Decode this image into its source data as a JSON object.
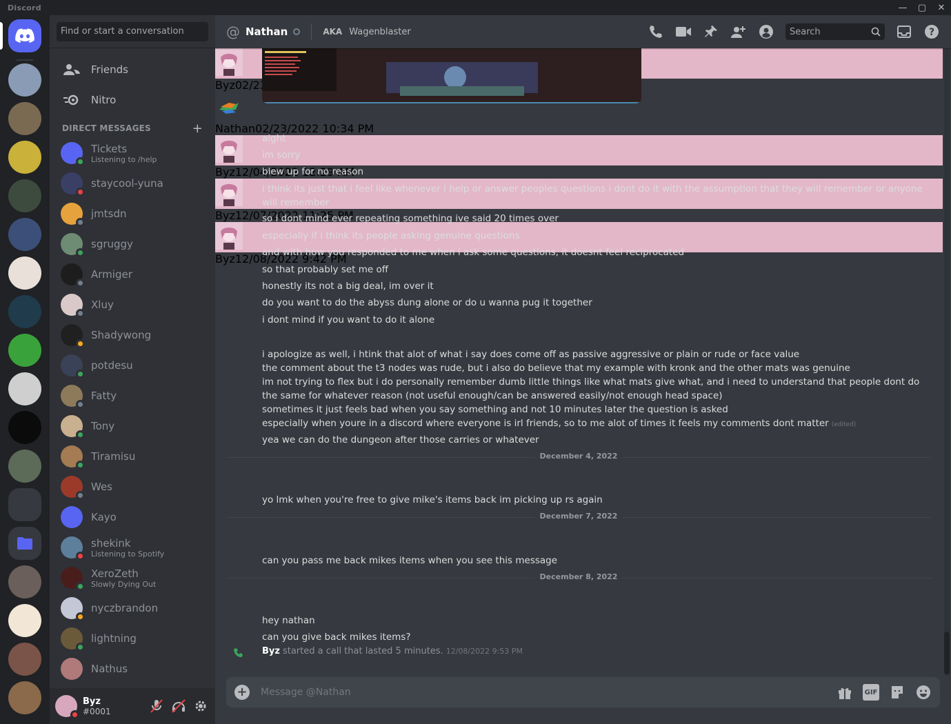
{
  "window": {
    "app_name": "Discord",
    "controls": [
      "minimize",
      "maximize",
      "close"
    ]
  },
  "sidebar": {
    "search_placeholder": "Find or start a conversation",
    "nav": [
      {
        "label": "Friends"
      },
      {
        "label": "Nitro"
      }
    ],
    "dm_header": "DIRECT MESSAGES",
    "dms": [
      {
        "name": "Tickets",
        "sub": "Listening to /help",
        "status": "online",
        "color": "#5865f2"
      },
      {
        "name": "staycool-yuna",
        "sub": "",
        "status": "dnd",
        "color": "#3a3f66"
      },
      {
        "name": "jmtsdn",
        "sub": "",
        "status": "offline",
        "color": "#e6a23c"
      },
      {
        "name": "sgruggy",
        "sub": "",
        "status": "online",
        "color": "#6e8b74"
      },
      {
        "name": "Armiger",
        "sub": "",
        "status": "offline",
        "color": "#1d1d1d"
      },
      {
        "name": "Xluy",
        "sub": "",
        "status": "offline",
        "color": "#d9c9c9"
      },
      {
        "name": "Shadywong",
        "sub": "",
        "status": "idle",
        "color": "#202020"
      },
      {
        "name": "potdesu",
        "sub": "",
        "status": "online",
        "color": "#3a4257"
      },
      {
        "name": "Fatty",
        "sub": "",
        "status": "offline",
        "color": "#8d7a5a"
      },
      {
        "name": "Tony",
        "sub": "",
        "status": "online",
        "color": "#c9b08f"
      },
      {
        "name": "Tiramisu",
        "sub": "",
        "status": "online",
        "color": "#a47b52"
      },
      {
        "name": "Wes",
        "sub": "",
        "status": "offline",
        "color": "#9c3a2a"
      },
      {
        "name": "Kayo",
        "sub": "",
        "status": "",
        "color": "#5865f2"
      },
      {
        "name": "shekink",
        "sub": "Listening to Spotify",
        "status": "dnd",
        "color": "#5d7f9c"
      },
      {
        "name": "XeroZeth",
        "sub": "Slowly Dying Out",
        "status": "online",
        "color": "#4a1d1d"
      },
      {
        "name": "nyczbrandon",
        "sub": "",
        "status": "idle",
        "color": "#c4c7d6"
      },
      {
        "name": "lightning",
        "sub": "",
        "status": "online",
        "color": "#6b5a3a"
      },
      {
        "name": "Nathus",
        "sub": "",
        "status": "",
        "color": "#b07a7a"
      }
    ],
    "user": {
      "name": "Byz",
      "discriminator": "#0001"
    }
  },
  "header": {
    "title": "Nathan",
    "aka_label": "AKA",
    "aka_name": "Wagenblaster",
    "search_placeholder": "Search"
  },
  "messages": [
    {
      "author": "Byz",
      "timestamp": "02/23/2022 10:25 PM",
      "lines": [
        "aight",
        "im sorry",
        "blew up for no reason",
        "i think its just that i feel like whenever i help or answer peoples questions i dont do it with the assumption that they will remember or anyone will remember",
        "so i dont mind ever repeating something ive said 20 times over",
        "especially if i think its people asking genuine questions",
        "and with how you responded to me when i ask some questions, it doesnt feel reciprocated",
        "so that probably set me off",
        "honestly its not a big deal, im over it",
        "do you want to do the abyss dung alone or do u wanna pug it together",
        "i dont mind if you want to do it alone"
      ]
    },
    {
      "author": "Nathan",
      "timestamp": "02/23/2022 10:34 PM",
      "lines": [
        "i apologize as well, i htink that alot of what i say does come off as passive aggressive or plain or rude or face value",
        "the comment about the t3 nodes was rude, but i also do believe that my example with kronk and the other mats was genuine",
        "im not trying to flex but i do personally remember dumb little things like what mats give what, and i need to understand that people dont do the same for whatever reason (not useful enough/can be answered easily/not enough head space)",
        "sometimes it just feels bad when you say something and not 10 minutes later the question is asked",
        "especially when youre in a discord where everyone is irl friends, so to me alot of times it feels my comments dont matter",
        "yea we can do the dungeon after those carries or whatever"
      ],
      "edited_label": "(edited)"
    },
    {
      "divider": "December 4, 2022"
    },
    {
      "author": "Byz",
      "timestamp": "12/04/2022 12:29 AM",
      "lines": [
        "yo lmk when you're free to give mike's items back im picking up rs again"
      ]
    },
    {
      "divider": "December 7, 2022"
    },
    {
      "author": "Byz",
      "timestamp": "12/07/2022 11:25 PM",
      "lines": [
        "can you pass me back mikes items when you see this message"
      ]
    },
    {
      "divider": "December 8, 2022"
    },
    {
      "author": "Byz",
      "timestamp": "12/08/2022 9:42 PM",
      "lines": [
        "hey nathan",
        "can you give back mikes items?"
      ]
    }
  ],
  "call_event": {
    "author": "Byz",
    "text": "started a call that lasted 5 minutes.",
    "timestamp": "12/08/2022 9:53 PM"
  },
  "composer": {
    "placeholder": "Message @Nathan",
    "gif_label": "GIF"
  },
  "colors": {
    "accent": "#5865f2",
    "online": "#3ba55d",
    "dnd": "#ed4245",
    "idle": "#faa81a",
    "offline": "#747f8d"
  }
}
